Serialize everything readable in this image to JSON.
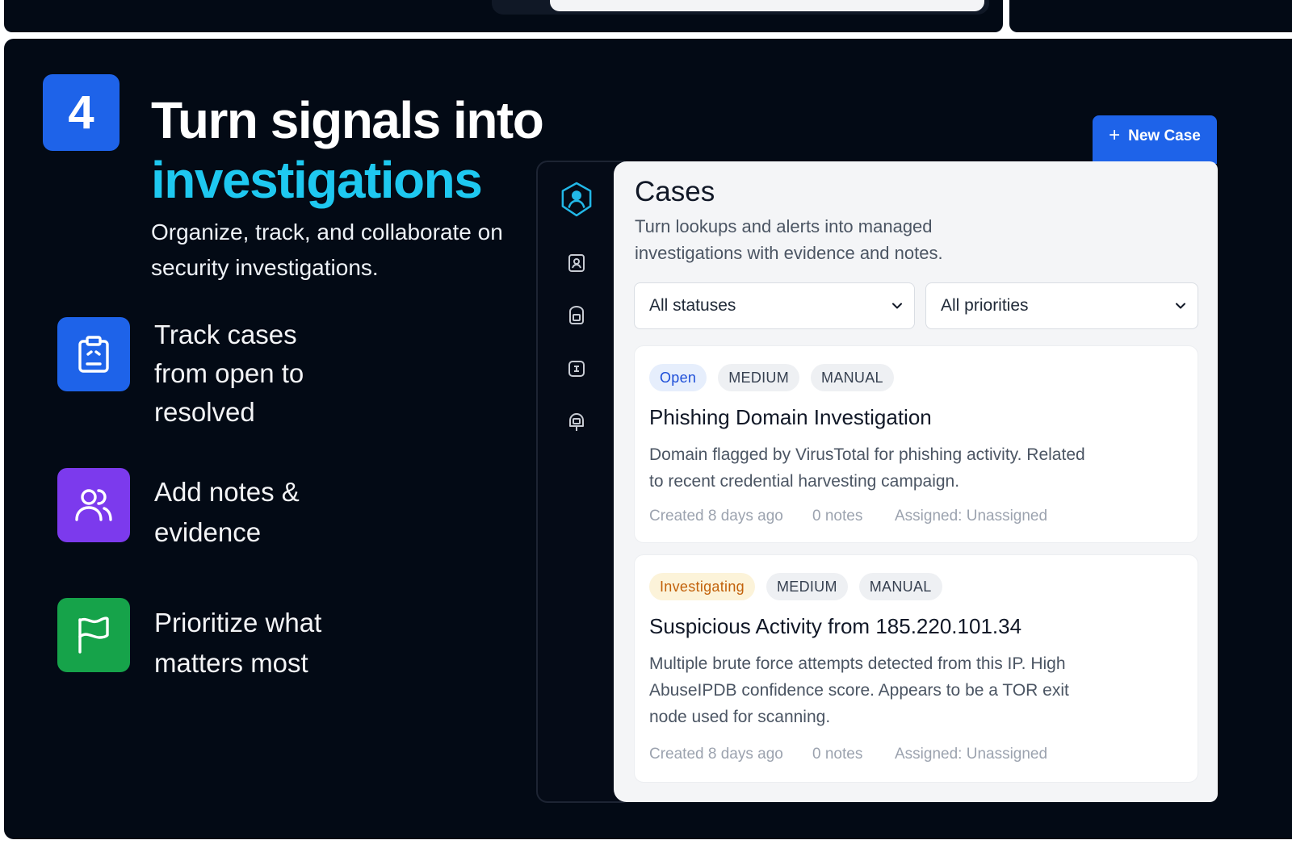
{
  "step": {
    "number": "4",
    "headline_line1": "Turn signals into",
    "headline_accent": "investigations",
    "subhead": "Organize, track, and collaborate on security investigations."
  },
  "features": [
    {
      "label": "Track cases from open to resolved",
      "icon": "clipboard-icon",
      "color": "#1e63e9"
    },
    {
      "label": "Add notes & evidence",
      "icon": "users-icon",
      "color": "#7c3aed"
    },
    {
      "label": "Prioritize what matters most",
      "icon": "flag-icon",
      "color": "#16a34a"
    }
  ],
  "toolbar": {
    "new_case_label": "New Case",
    "new_case_icon": "plus-icon"
  },
  "rail": {
    "icons": [
      "shield-user-icon",
      "badge-icon",
      "lock-badge-icon",
      "link-badge-icon",
      "bell-badge-icon"
    ]
  },
  "cases_view": {
    "title": "Cases",
    "description": "Turn lookups and alerts into managed investigations with evidence and notes.",
    "filters": {
      "status": "All statuses",
      "priority": "All priorities"
    },
    "items": [
      {
        "status": "Open",
        "priority": "MEDIUM",
        "source": "MANUAL",
        "title": "Phishing Domain Investigation",
        "description": "Domain flagged by VirusTotal for phishing activity. Related to recent credential harvesting campaign.",
        "created": "Created 8 days ago",
        "notes": "0 notes",
        "assigned": "Assigned: Unassigned"
      },
      {
        "status": "Investigating",
        "priority": "MEDIUM",
        "source": "MANUAL",
        "title": "Suspicious Activity from 185.220.101.34",
        "description": "Multiple brute force attempts detected from this IP. High AbuseIPDB confidence score. Appears to be a TOR exit node used for scanning.",
        "created": "Created 8 days ago",
        "notes": "0 notes",
        "assigned": "Assigned: Unassigned"
      }
    ]
  },
  "colors": {
    "background": "#030a15",
    "accent": "#1ec8f0",
    "primary": "#1e63e9",
    "status_open": "#1d4ed8",
    "status_investigating": "#c2610a"
  }
}
